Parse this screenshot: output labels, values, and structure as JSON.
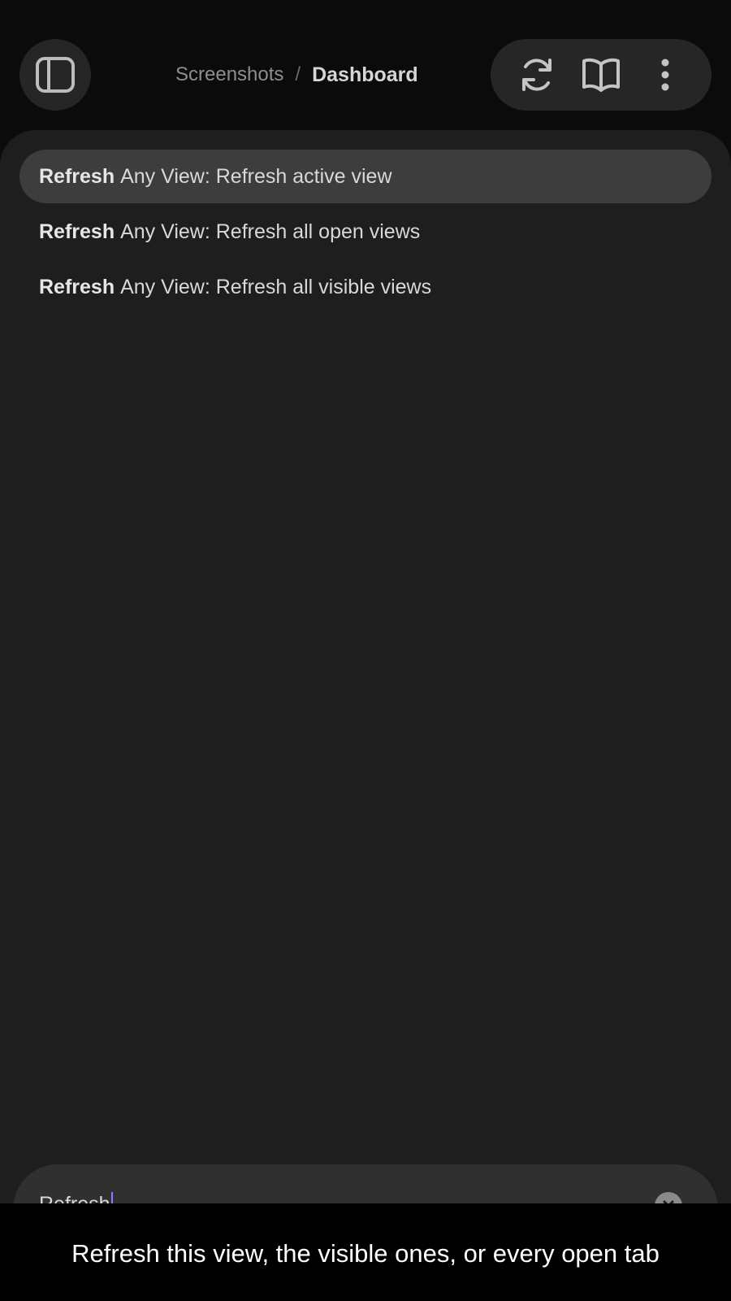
{
  "header": {
    "breadcrumb_parent": "Screenshots",
    "breadcrumb_separator": "/",
    "breadcrumb_current": "Dashboard",
    "icons": [
      "sidebar-toggle-icon",
      "refresh-icon",
      "book-open-icon",
      "more-vertical-icon"
    ]
  },
  "results": [
    {
      "match": "Refresh",
      "rest": "Any View: Refresh active view",
      "selected": true
    },
    {
      "match": "Refresh",
      "rest": "Any View: Refresh all open views",
      "selected": false
    },
    {
      "match": "Refresh",
      "rest": "Any View: Refresh all visible views",
      "selected": false
    }
  ],
  "search": {
    "value": "Refresh"
  },
  "caption": "Refresh this view, the visible ones, or every open tab",
  "colors": {
    "background": "#0b0b0b",
    "panel": "#1e1e1e",
    "selected_row": "#3d3d3d",
    "cursor": "#8a7dff"
  }
}
